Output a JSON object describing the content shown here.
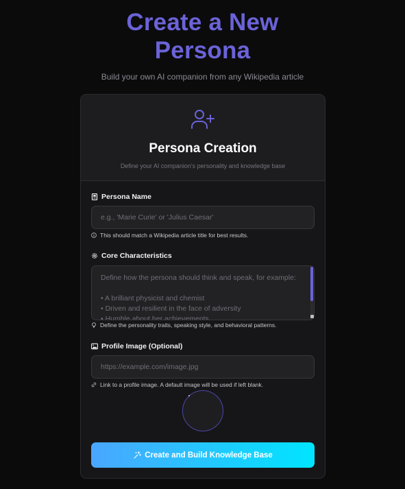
{
  "hero": {
    "title_line1": "Create a New",
    "title_line2": "Persona",
    "subtitle": "Build your own AI companion from any Wikipedia article"
  },
  "card": {
    "icon": "user-plus-icon",
    "title": "Persona Creation",
    "description": "Define your AI companion's personality and knowledge base"
  },
  "form": {
    "name": {
      "label": "Persona Name",
      "icon": "id-card-icon",
      "placeholder": "e.g., 'Marie Curie' or 'Julius Caesar'",
      "value": "",
      "hint_icon": "info-icon",
      "hint": "This should match a Wikipedia article title for best results."
    },
    "characteristics": {
      "label": "Core Characteristics",
      "icon": "gear-icon",
      "placeholder": "Define how the persona should think and speak, for example:\n\n• A brilliant physicist and chemist\n• Driven and resilient in the face of adversity\n• Humble about her achievements",
      "value": "",
      "hint_icon": "lightbulb-icon",
      "hint": "Define the personality traits, speaking style, and behavioral patterns."
    },
    "image": {
      "label": "Profile Image (Optional)",
      "icon": "image-icon",
      "placeholder": "https://example.com/image.jpg",
      "value": "",
      "hint_icon": "link-icon",
      "hint": "Link to a profile image. A default image will be used if left blank."
    },
    "submit": {
      "icon": "magic-wand-icon",
      "label": "Create and Build Knowledge Base"
    }
  },
  "colors": {
    "accent": "#6b63d8",
    "background": "#0b0b0c",
    "card": "#161618",
    "button_start": "#4aa6ff",
    "button_end": "#00e5ff"
  }
}
